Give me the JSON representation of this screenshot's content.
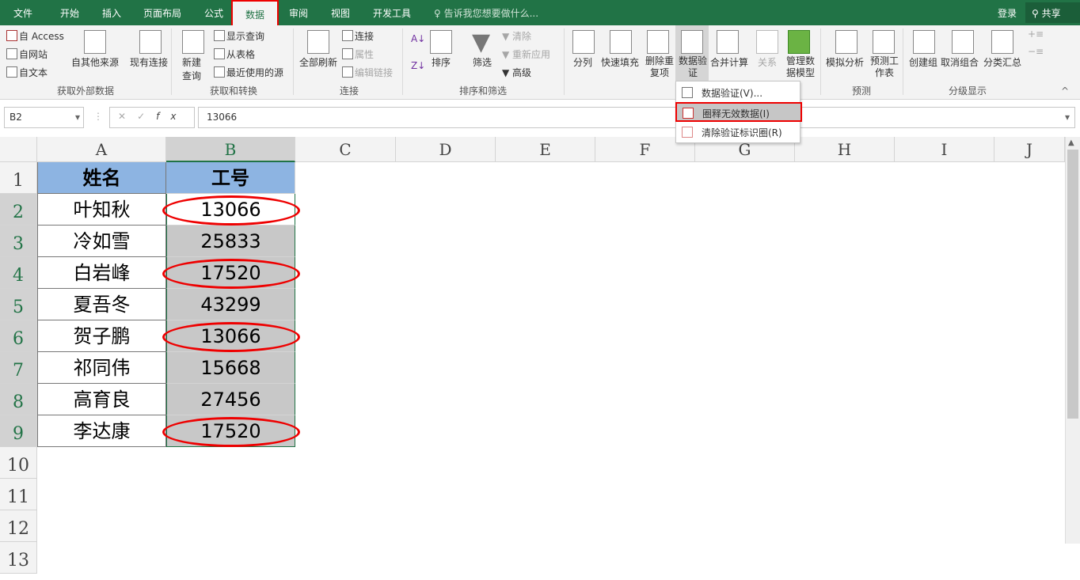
{
  "tabs": [
    "文件",
    "开始",
    "插入",
    "页面布局",
    "公式",
    "数据",
    "审阅",
    "视图",
    "开发工具"
  ],
  "active_tab": "数据",
  "tell_me": "告诉我您想要做什么...",
  "login": "登录",
  "share": "共享",
  "ribbon": {
    "get_external": {
      "label": "获取外部数据",
      "items": [
        "自 Access",
        "自网站",
        "自文本",
        "自其他来源",
        "现有连接"
      ]
    },
    "get_transform": {
      "label": "获取和转换",
      "items": [
        "新建查询",
        "显示查询",
        "从表格",
        "最近使用的源"
      ]
    },
    "connections": {
      "label": "连接",
      "items": [
        "全部刷新",
        "连接",
        "属性",
        "编辑链接"
      ]
    },
    "sort_filter": {
      "label": "排序和筛选",
      "items": [
        "排序",
        "筛选",
        "清除",
        "重新应用",
        "高级"
      ]
    },
    "data_tools": {
      "items": [
        "分列",
        "快速填充",
        "删除重复项",
        "数据验证",
        "合并计算",
        "关系",
        "管理数据模型"
      ]
    },
    "forecast": {
      "label": "预测",
      "items": [
        "模拟分析",
        "预测工作表"
      ]
    },
    "outline": {
      "label": "分级显示",
      "items": [
        "创建组",
        "取消组合",
        "分类汇总"
      ]
    }
  },
  "dropdown": [
    "数据验证(V)...",
    "圈释无效数据(I)",
    "清除验证标识圈(R)"
  ],
  "name_box": "B2",
  "formula": "13066",
  "columns": [
    "A",
    "B",
    "C",
    "D",
    "E",
    "F",
    "G",
    "H",
    "I",
    "J"
  ],
  "rows": [
    "1",
    "2",
    "3",
    "4",
    "5",
    "6",
    "7",
    "8",
    "9",
    "10",
    "11",
    "12",
    "13"
  ],
  "table": {
    "headers": [
      "姓名",
      "工号"
    ],
    "data": [
      [
        "叶知秋",
        "13066"
      ],
      [
        "冷如雪",
        "25833"
      ],
      [
        "白岩峰",
        "17520"
      ],
      [
        "夏吾冬",
        "43299"
      ],
      [
        "贺子鹏",
        "13066"
      ],
      [
        "祁同伟",
        "15668"
      ],
      [
        "高育良",
        "27456"
      ],
      [
        "李达康",
        "17520"
      ]
    ],
    "invalid_circled": [
      "13066",
      "17520",
      "13066",
      "17520"
    ]
  },
  "colors": {
    "excel_green": "#217346",
    "header_fill": "#8db4e2",
    "circle": "#ee0000"
  }
}
